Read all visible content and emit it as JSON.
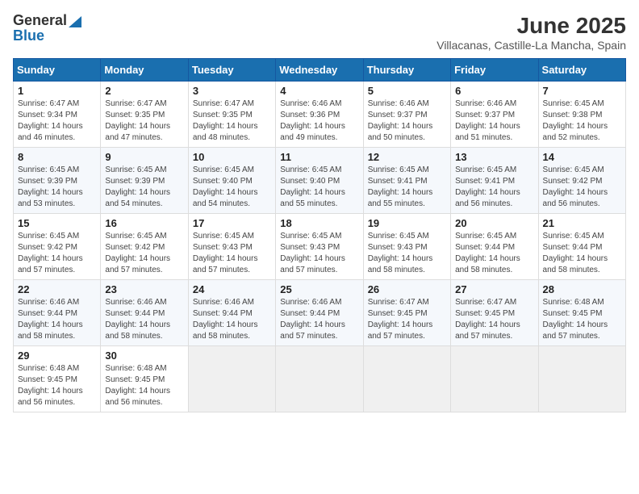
{
  "header": {
    "logo_general": "General",
    "logo_blue": "Blue",
    "month_year": "June 2025",
    "location": "Villacanas, Castille-La Mancha, Spain"
  },
  "weekdays": [
    "Sunday",
    "Monday",
    "Tuesday",
    "Wednesday",
    "Thursday",
    "Friday",
    "Saturday"
  ],
  "weeks": [
    [
      {
        "day": "1",
        "sunrise": "6:47 AM",
        "sunset": "9:34 PM",
        "daylight": "14 hours and 46 minutes."
      },
      {
        "day": "2",
        "sunrise": "6:47 AM",
        "sunset": "9:35 PM",
        "daylight": "14 hours and 47 minutes."
      },
      {
        "day": "3",
        "sunrise": "6:47 AM",
        "sunset": "9:35 PM",
        "daylight": "14 hours and 48 minutes."
      },
      {
        "day": "4",
        "sunrise": "6:46 AM",
        "sunset": "9:36 PM",
        "daylight": "14 hours and 49 minutes."
      },
      {
        "day": "5",
        "sunrise": "6:46 AM",
        "sunset": "9:37 PM",
        "daylight": "14 hours and 50 minutes."
      },
      {
        "day": "6",
        "sunrise": "6:46 AM",
        "sunset": "9:37 PM",
        "daylight": "14 hours and 51 minutes."
      },
      {
        "day": "7",
        "sunrise": "6:45 AM",
        "sunset": "9:38 PM",
        "daylight": "14 hours and 52 minutes."
      }
    ],
    [
      {
        "day": "8",
        "sunrise": "6:45 AM",
        "sunset": "9:39 PM",
        "daylight": "14 hours and 53 minutes."
      },
      {
        "day": "9",
        "sunrise": "6:45 AM",
        "sunset": "9:39 PM",
        "daylight": "14 hours and 54 minutes."
      },
      {
        "day": "10",
        "sunrise": "6:45 AM",
        "sunset": "9:40 PM",
        "daylight": "14 hours and 54 minutes."
      },
      {
        "day": "11",
        "sunrise": "6:45 AM",
        "sunset": "9:40 PM",
        "daylight": "14 hours and 55 minutes."
      },
      {
        "day": "12",
        "sunrise": "6:45 AM",
        "sunset": "9:41 PM",
        "daylight": "14 hours and 55 minutes."
      },
      {
        "day": "13",
        "sunrise": "6:45 AM",
        "sunset": "9:41 PM",
        "daylight": "14 hours and 56 minutes."
      },
      {
        "day": "14",
        "sunrise": "6:45 AM",
        "sunset": "9:42 PM",
        "daylight": "14 hours and 56 minutes."
      }
    ],
    [
      {
        "day": "15",
        "sunrise": "6:45 AM",
        "sunset": "9:42 PM",
        "daylight": "14 hours and 57 minutes."
      },
      {
        "day": "16",
        "sunrise": "6:45 AM",
        "sunset": "9:42 PM",
        "daylight": "14 hours and 57 minutes."
      },
      {
        "day": "17",
        "sunrise": "6:45 AM",
        "sunset": "9:43 PM",
        "daylight": "14 hours and 57 minutes."
      },
      {
        "day": "18",
        "sunrise": "6:45 AM",
        "sunset": "9:43 PM",
        "daylight": "14 hours and 57 minutes."
      },
      {
        "day": "19",
        "sunrise": "6:45 AM",
        "sunset": "9:43 PM",
        "daylight": "14 hours and 58 minutes."
      },
      {
        "day": "20",
        "sunrise": "6:45 AM",
        "sunset": "9:44 PM",
        "daylight": "14 hours and 58 minutes."
      },
      {
        "day": "21",
        "sunrise": "6:45 AM",
        "sunset": "9:44 PM",
        "daylight": "14 hours and 58 minutes."
      }
    ],
    [
      {
        "day": "22",
        "sunrise": "6:46 AM",
        "sunset": "9:44 PM",
        "daylight": "14 hours and 58 minutes."
      },
      {
        "day": "23",
        "sunrise": "6:46 AM",
        "sunset": "9:44 PM",
        "daylight": "14 hours and 58 minutes."
      },
      {
        "day": "24",
        "sunrise": "6:46 AM",
        "sunset": "9:44 PM",
        "daylight": "14 hours and 58 minutes."
      },
      {
        "day": "25",
        "sunrise": "6:46 AM",
        "sunset": "9:44 PM",
        "daylight": "14 hours and 57 minutes."
      },
      {
        "day": "26",
        "sunrise": "6:47 AM",
        "sunset": "9:45 PM",
        "daylight": "14 hours and 57 minutes."
      },
      {
        "day": "27",
        "sunrise": "6:47 AM",
        "sunset": "9:45 PM",
        "daylight": "14 hours and 57 minutes."
      },
      {
        "day": "28",
        "sunrise": "6:48 AM",
        "sunset": "9:45 PM",
        "daylight": "14 hours and 57 minutes."
      }
    ],
    [
      {
        "day": "29",
        "sunrise": "6:48 AM",
        "sunset": "9:45 PM",
        "daylight": "14 hours and 56 minutes."
      },
      {
        "day": "30",
        "sunrise": "6:48 AM",
        "sunset": "9:45 PM",
        "daylight": "14 hours and 56 minutes."
      },
      null,
      null,
      null,
      null,
      null
    ]
  ]
}
